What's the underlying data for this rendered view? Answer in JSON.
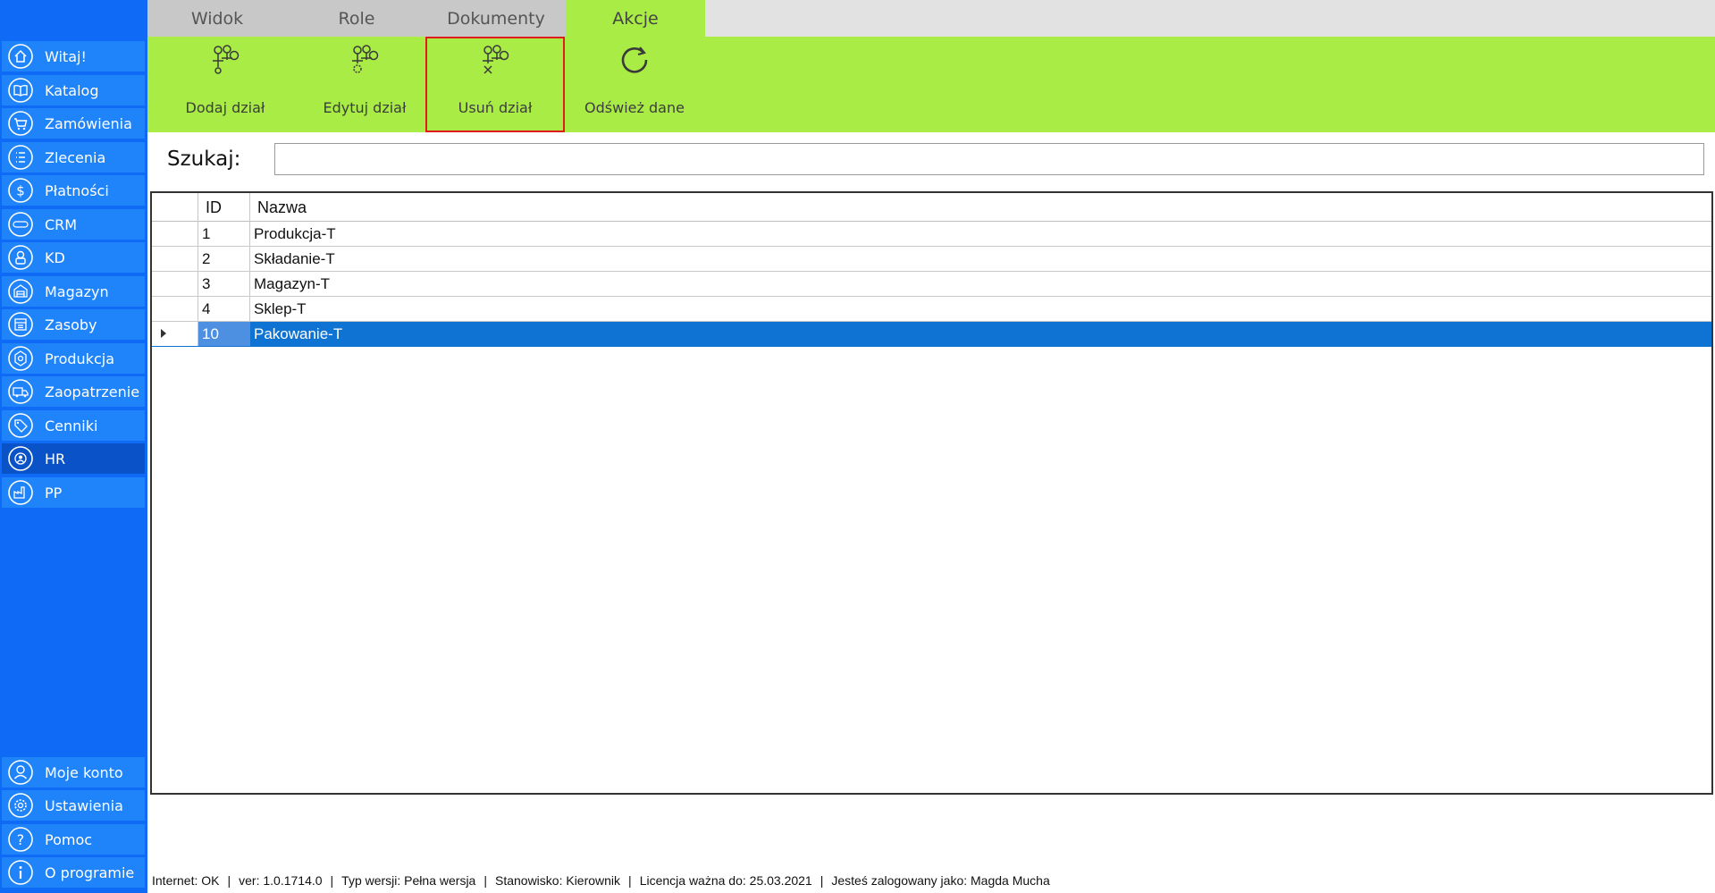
{
  "sidebar": {
    "items": [
      {
        "label": "Witaj!",
        "icon": "home-icon"
      },
      {
        "label": "Katalog",
        "icon": "book-icon"
      },
      {
        "label": "Zamówienia",
        "icon": "cart-icon"
      },
      {
        "label": "Zlecenia",
        "icon": "list-icon"
      },
      {
        "label": "Płatności",
        "icon": "dollar-icon"
      },
      {
        "label": "CRM",
        "icon": "crm-icon"
      },
      {
        "label": "KD",
        "icon": "lock-person-icon"
      },
      {
        "label": "Magazyn",
        "icon": "warehouse-icon"
      },
      {
        "label": "Zasoby",
        "icon": "resources-icon"
      },
      {
        "label": "Produkcja",
        "icon": "production-icon"
      },
      {
        "label": "Zaopatrzenie",
        "icon": "truck-icon"
      },
      {
        "label": "Cenniki",
        "icon": "tag-icon"
      },
      {
        "label": "HR",
        "icon": "hr-icon"
      },
      {
        "label": "PP",
        "icon": "factory-icon"
      }
    ],
    "bottom_items": [
      {
        "label": "Moje konto",
        "icon": "user-icon"
      },
      {
        "label": "Ustawienia",
        "icon": "gear-icon"
      },
      {
        "label": "Pomoc",
        "icon": "help-icon"
      },
      {
        "label": "O programie",
        "icon": "info-icon"
      }
    ],
    "active_item": "HR",
    "accent": "#0f6af6"
  },
  "tabs": [
    {
      "label": "Widok"
    },
    {
      "label": "Role"
    },
    {
      "label": "Dokumenty"
    },
    {
      "label": "Akcje"
    }
  ],
  "active_tab": "Akcje",
  "ribbon": {
    "color": "#a8ec45",
    "buttons": [
      {
        "label": "Dodaj dział",
        "icon": "add-department-icon"
      },
      {
        "label": "Edytuj dział",
        "icon": "edit-department-icon"
      },
      {
        "label": "Usuń dział",
        "icon": "delete-department-icon"
      },
      {
        "label": "Odśwież dane",
        "icon": "refresh-icon"
      }
    ],
    "highlighted_button": "Usuń dział",
    "highlight_color": "#e01b1b"
  },
  "search": {
    "label": "Szukaj:",
    "value": ""
  },
  "grid": {
    "columns": [
      "ID",
      "Nazwa"
    ],
    "rows": [
      {
        "id": "1",
        "name": "Produkcja-T"
      },
      {
        "id": "2",
        "name": "Składanie-T"
      },
      {
        "id": "3",
        "name": "Magazyn-T"
      },
      {
        "id": "4",
        "name": "Sklep-T"
      },
      {
        "id": "10",
        "name": "Pakowanie-T"
      }
    ],
    "selected_row": "10",
    "selection_color": "#0f73d4"
  },
  "status": {
    "internet": "Internet: OK",
    "version": "ver: 1.0.1714.0",
    "type": "Typ wersji: Pełna wersja",
    "position": "Stanowisko: Kierownik",
    "license": "Licencja ważna do: 25.03.2021",
    "user": "Jesteś zalogowany jako: Magda Mucha",
    "separator": "|"
  }
}
